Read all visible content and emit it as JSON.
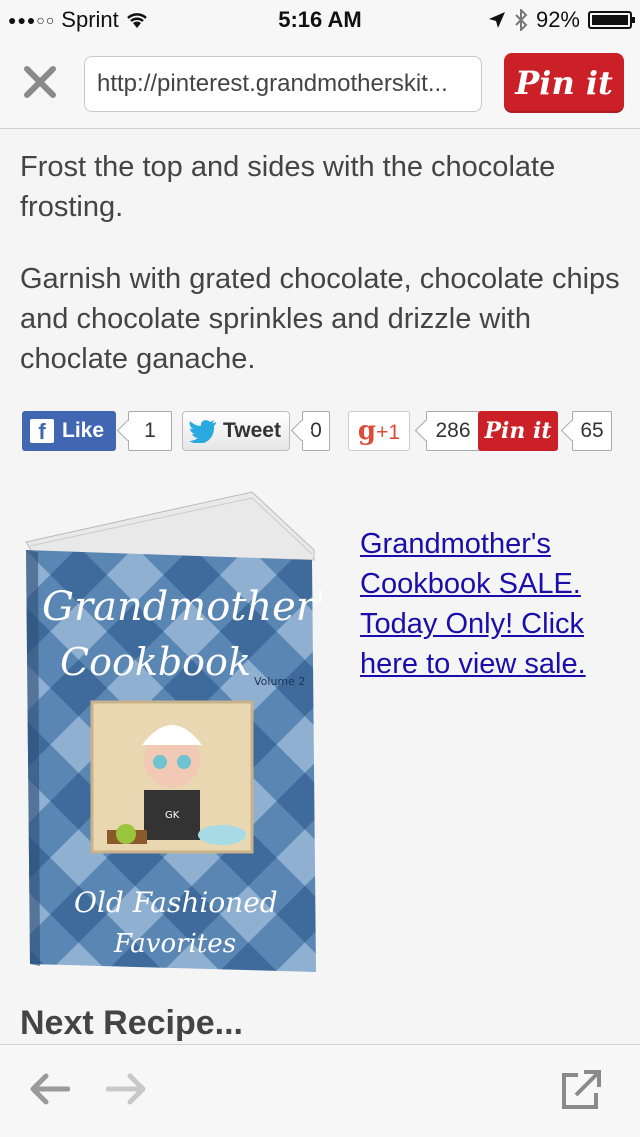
{
  "status": {
    "carrier": "Sprint",
    "time": "5:16 AM",
    "battery": "92%"
  },
  "toolbar": {
    "url": "http://pinterest.grandmotherskit...",
    "pin_button": "Pin it"
  },
  "article": {
    "paragraph1": "Frost the top and sides with the chocolate frosting.",
    "paragraph2": "Garnish with grated chocolate, chocolate chips and chocolate sprinkles and drizzle with choclate ganache."
  },
  "share": {
    "facebook_label": "Like",
    "facebook_count": "1",
    "twitter_label": "Tweet",
    "twitter_count": "0",
    "gplus_label": "+1",
    "gplus_count": "286",
    "pinterest_label": "Pin it",
    "pinterest_count": "65"
  },
  "promo": {
    "book_title_line1": "Grandmother's",
    "book_title_line2": "Cookbook",
    "book_volume": "Volume 2",
    "book_subtitle_line1": "Old Fashioned",
    "book_subtitle_line2": "Favorites",
    "book_badge": "GK",
    "sale_link": "Grandmother's Cookbook SALE. Today Only! Click here to view sale."
  },
  "next_heading": "Next Recipe...",
  "colors": {
    "pinterest_red": "#cb2027",
    "facebook_blue": "#4267b2",
    "link_blue": "#1a0dab"
  }
}
